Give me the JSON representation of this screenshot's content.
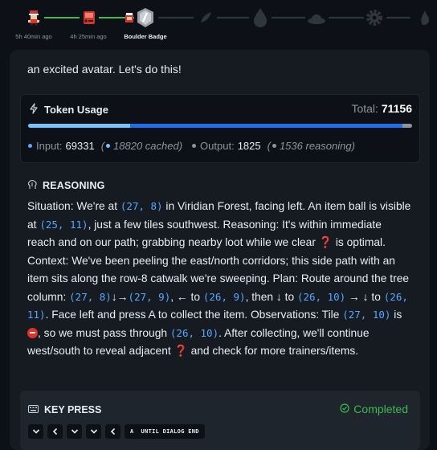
{
  "timeline": {
    "nodes": [
      {
        "icon": "trainer-sprite-icon",
        "label": "5h 40min ago"
      },
      {
        "icon": "pokedex-item-icon",
        "label": "4h 25min ago"
      },
      {
        "icon": "boulder-badge-icon",
        "label": "Boulder Badge"
      },
      {
        "icon": "cascade-badge-locked-icon",
        "label": ""
      },
      {
        "icon": "water-drop-locked-icon",
        "label": ""
      },
      {
        "icon": "cloud-locked-icon",
        "label": ""
      },
      {
        "icon": "gear-locked-icon",
        "label": ""
      },
      {
        "icon": "flame-locked-icon",
        "label": ""
      }
    ]
  },
  "intro_text": "an excited avatar. Let's do this!",
  "token_usage": {
    "title": "Token Usage",
    "total_label": "Total:",
    "total_value": "71156",
    "input_label": "Input:",
    "input_value": "69331",
    "cached_text": "18820 cached)",
    "output_label": "Output:",
    "output_value": "1825",
    "reasoning_text": "1536 reasoning)",
    "cached_fraction": 0.265,
    "input_fraction": 0.974,
    "colors": {
      "cached": "#79c0ff",
      "input": "#1f6feb",
      "output": "#8b949e"
    }
  },
  "reasoning": {
    "title": "REASONING",
    "t1": "Situation: We're at ",
    "c1": "(27, 8)",
    "t2": " in Viridian Forest, facing left. An item ball is visible at ",
    "c2": "(25, 11)",
    "t3": ", just a few tiles southwest. Reasoning: It's within immediate reach and on our path; grabbing nearby loot while we clear ",
    "t4": " is optimal. Context: We've been peeling the east/north corridors; this side path with an item sits along the row-8 catwalk we're sweeping. Plan: Route around the tree column: ",
    "c3": "(27, 8)",
    "t5": "↓→",
    "c4": "(27, 9)",
    "t6": ", ← to ",
    "c5": "(26, 9)",
    "t7": ", then ↓ to ",
    "c6": "(26, 10)",
    "t8": " → ↓ to ",
    "c7": "(26, 11)",
    "t9": ". Face left and press A to collect the item. Observations: Tile ",
    "c8": "(27, 10)",
    "t10": " is ",
    "t11": ", so we must pass through ",
    "c9": "(26, 10)",
    "t12": ". After collecting, we'll continue west/south to reveal adjacent ",
    "t13": " and check for more trainers/items.",
    "question_mark": "❓"
  },
  "key_press": {
    "title": "KEY PRESS",
    "status": "Completed",
    "keys": [
      "⌄",
      "‹",
      "⌄",
      "⌄",
      "‹",
      "A  UNTIL DIALOG END"
    ]
  }
}
